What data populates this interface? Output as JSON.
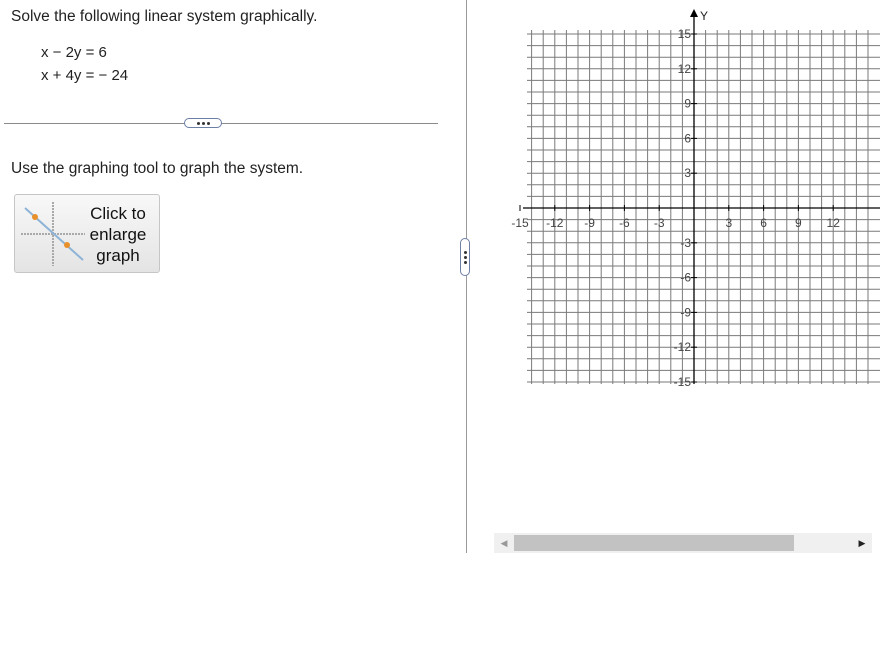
{
  "problem": {
    "instruction": "Solve the following linear system graphically.",
    "equations": [
      "x − 2y = 6",
      "x + 4y =  − 24"
    ],
    "tool_instruction": "Use the graphing tool to graph the system."
  },
  "enlarge_button": {
    "label_line1": "Click to",
    "label_line2": "enlarge",
    "label_line3": "graph"
  },
  "graph": {
    "y_axis_label": "Y",
    "x_ticks": [
      "-15",
      "-12",
      "-9",
      "-6",
      "-3",
      "3",
      "6",
      "9",
      "12"
    ],
    "y_ticks": [
      "15",
      "12",
      "9",
      "6",
      "3",
      "-3",
      "-6",
      "-9",
      "-12",
      "-15"
    ],
    "x_range": [
      -15,
      15
    ],
    "y_range": [
      -15,
      15
    ],
    "grid_step": 1,
    "grid_color": "#7a7a7a",
    "axis_color": "#000000"
  },
  "icons": {
    "more": "ellipsis-icon",
    "thumbnail": "graph-thumbnail-icon",
    "scroll_left": "arrow-left-icon",
    "scroll_right": "arrow-right-icon"
  }
}
